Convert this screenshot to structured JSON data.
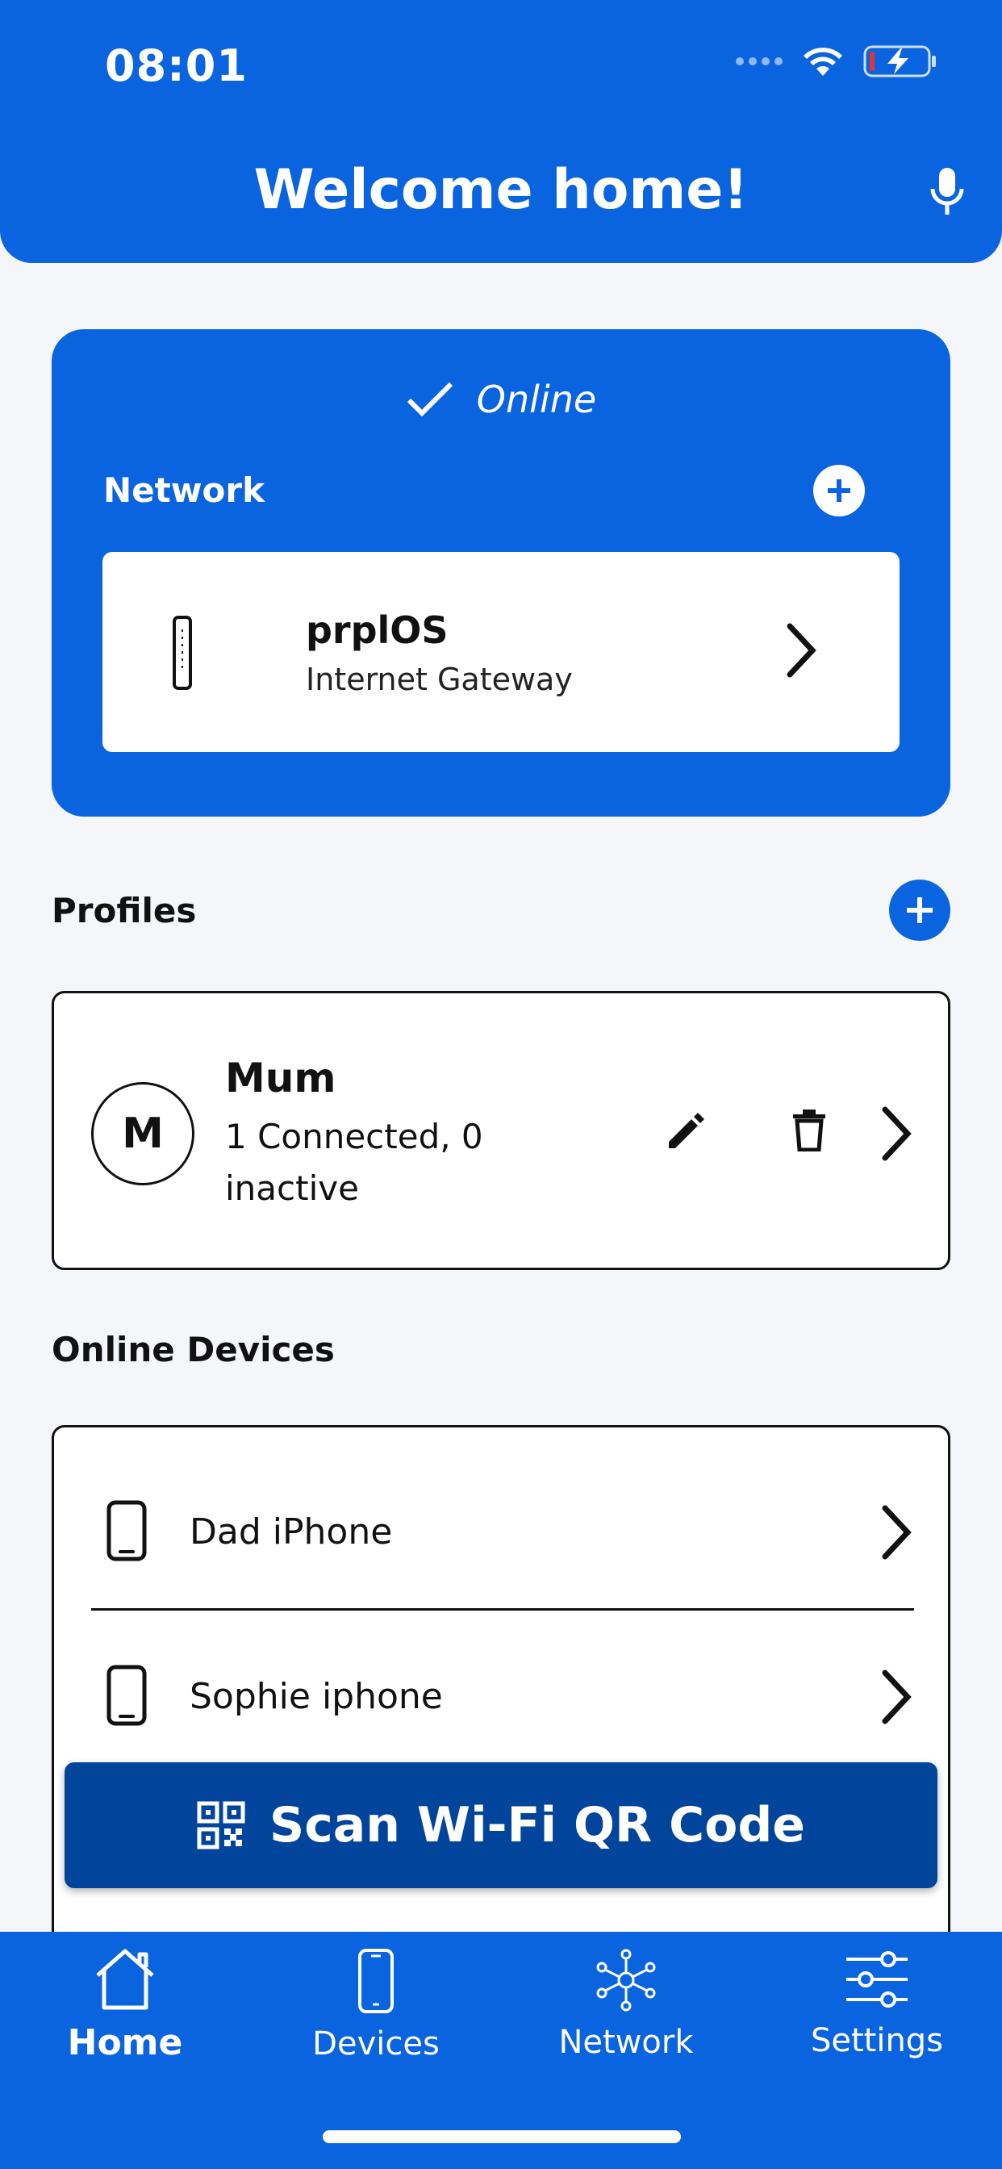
{
  "status_bar": {
    "time": "08:01"
  },
  "header": {
    "title": "Welcome home!",
    "mic_icon": "microphone-icon"
  },
  "network": {
    "status": "Online",
    "label": "Network",
    "gateway": {
      "name": "prplOS",
      "type": "Internet Gateway"
    }
  },
  "profiles": {
    "title": "Profiles",
    "items": [
      {
        "initial": "M",
        "name": "Mum",
        "status": "1 Connected, 0 inactive"
      }
    ]
  },
  "online_devices": {
    "title": "Online Devices",
    "items": [
      {
        "name": "Dad iPhone"
      },
      {
        "name": "Sophie iphone"
      }
    ]
  },
  "scan_button": {
    "label": "Scan Wi-Fi QR Code"
  },
  "tabbar": {
    "tabs": [
      {
        "label": "Home",
        "active": true
      },
      {
        "label": "Devices",
        "active": false
      },
      {
        "label": "Network",
        "active": false
      },
      {
        "label": "Settings",
        "active": false
      }
    ]
  },
  "colors": {
    "primary": "#0a64df",
    "scan_button": "#00449b",
    "background": "#f4f6fa"
  }
}
